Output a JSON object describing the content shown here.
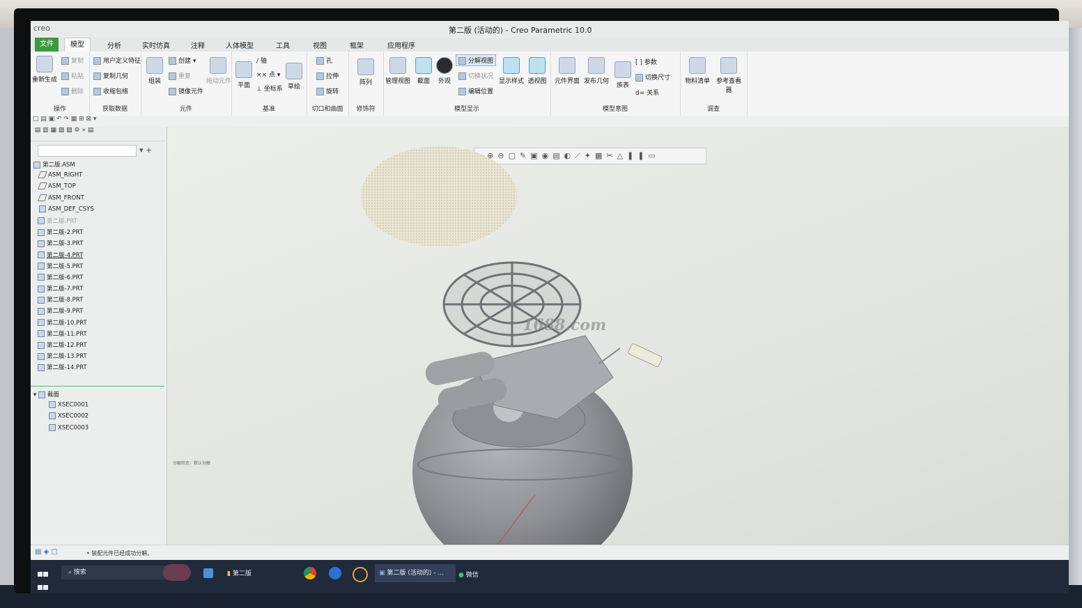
{
  "app": {
    "logo": "creo",
    "window_title": "第二版 (活动的) - Creo Parametric 10.0"
  },
  "tabs": [
    "文件",
    "模型",
    "分析",
    "实时仿真",
    "注释",
    "人体模型",
    "工具",
    "视图",
    "框架",
    "应用程序"
  ],
  "ribbon": {
    "operations": {
      "regen": "重新生成",
      "copy": "复制",
      "paste": "粘贴",
      "delete": "删除",
      "label": "操作"
    },
    "get_data": {
      "udf": "用户定义特征",
      "copy_geom": "复制几何",
      "shrinkwrap": "收缩包络",
      "label": "获取数据"
    },
    "component": {
      "assemble": "组装",
      "create": "创建",
      "repeat": "重复",
      "mirror": "镜像元件",
      "drag": "拖动元件",
      "label": "元件"
    },
    "datum": {
      "plane": "平面",
      "axis": "轴",
      "point": "点",
      "csys": "坐标系",
      "sketch": "草绘",
      "label": "基准"
    },
    "cut_surface": {
      "hole": "孔",
      "extrude": "拉伸",
      "revolve": "旋转",
      "label": "切口和曲面"
    },
    "modifiers": {
      "pattern": "阵列",
      "label": "修饰符"
    },
    "model_display": {
      "manage_views": "管理视图",
      "section": "截面",
      "appearance": "外观",
      "explode": "分解视图",
      "toggle_state": "切换状况",
      "edit_position": "编辑位置",
      "display_style": "显示样式",
      "perspective": "透视图",
      "label": "模型显示"
    },
    "model_intent": {
      "comp_interface": "元件界面",
      "publish_geom": "发布几何",
      "family_table": "族表",
      "params": "参数",
      "switch_dims": "切换尺寸",
      "relations": "关系",
      "label": "模型意图"
    },
    "investigate": {
      "bom": "物料清单",
      "ref_viewer": "参考查看器",
      "label": "调查"
    }
  },
  "tree": {
    "root": "第二版.ASM",
    "nodes": [
      {
        "label": "ASM_RIGHT",
        "kind": "plane"
      },
      {
        "label": "ASM_TOP",
        "kind": "plane"
      },
      {
        "label": "ASM_FRONT",
        "kind": "plane"
      },
      {
        "label": "ASM_DEF_CSYS",
        "kind": "csys"
      },
      {
        "label": "第二版.PRT",
        "kind": "part-dim"
      },
      {
        "label": "第二版-2.PRT",
        "kind": "part"
      },
      {
        "label": "第二版-3.PRT",
        "kind": "part"
      },
      {
        "label": "第二版-4.PRT",
        "kind": "part-u"
      },
      {
        "label": "第二版-5.PRT",
        "kind": "part"
      },
      {
        "label": "第二版-6.PRT",
        "kind": "part"
      },
      {
        "label": "第二版-7.PRT",
        "kind": "part"
      },
      {
        "label": "第二版-8.PRT",
        "kind": "part"
      },
      {
        "label": "第二版-9.PRT",
        "kind": "part"
      },
      {
        "label": "第二版-10.PRT",
        "kind": "part"
      },
      {
        "label": "第二版-11.PRT",
        "kind": "part"
      },
      {
        "label": "第二版-12.PRT",
        "kind": "part"
      },
      {
        "label": "第二版-13.PRT",
        "kind": "part"
      },
      {
        "label": "第二版-14.PRT",
        "kind": "part"
      }
    ],
    "sections_label": "截面",
    "sections": [
      "XSEC0001",
      "XSEC0002",
      "XSEC0003"
    ]
  },
  "viewport": {
    "watermark": "1688.com",
    "small_status": "分解状态：默认分解"
  },
  "status": {
    "message": "• 装配元件已经成功分解。"
  },
  "taskbar": {
    "search": "搜索",
    "explorer_folder": "第二版",
    "creo_window": "第二版 (活动的) - ...",
    "wechat": "微信"
  }
}
